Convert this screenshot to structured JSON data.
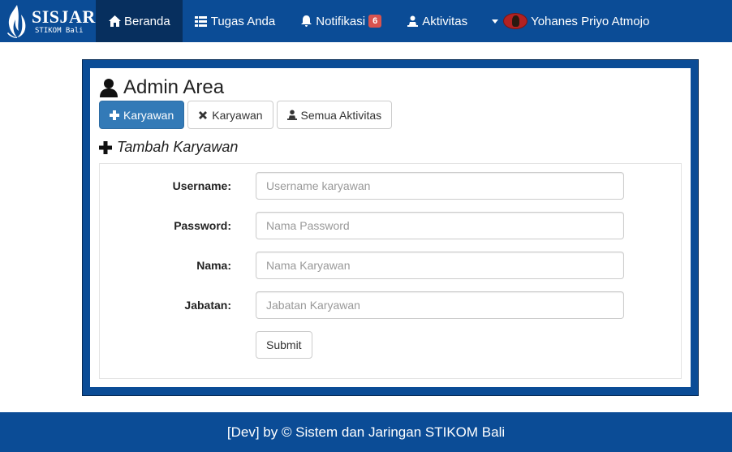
{
  "brand": {
    "title": "SISJAR",
    "subtitle": "STIKOM Bali"
  },
  "nav": {
    "items": [
      {
        "label": "Beranda",
        "icon": "home-icon"
      },
      {
        "label": "Tugas Anda",
        "icon": "list-icon"
      },
      {
        "label": "Notifikasi",
        "icon": "bell-icon",
        "badge": "6"
      },
      {
        "label": "Aktivitas",
        "icon": "user-icon"
      }
    ],
    "user": {
      "name": "Yohanes Priyo Atmojo"
    }
  },
  "page": {
    "title": "Admin Area",
    "buttons": {
      "add": "Karyawan",
      "remove": "Karyawan",
      "all": "Semua Aktivitas"
    },
    "section_title": "Tambah Karyawan"
  },
  "form": {
    "username": {
      "label": "Username:",
      "placeholder": "Username karyawan"
    },
    "password": {
      "label": "Password:",
      "placeholder": "Nama Password"
    },
    "nama": {
      "label": "Nama:",
      "placeholder": "Nama Karyawan"
    },
    "jabatan": {
      "label": "Jabatan:",
      "placeholder": "Jabatan Karyawan"
    },
    "submit": "Submit"
  },
  "footer": {
    "text": "[Dev] by © Sistem dan Jaringan STIKOM Bali"
  },
  "colors": {
    "navbar": "#0b4c96",
    "active_nav": "#072f5e",
    "primary": "#337ab7",
    "badge": "#d9534f"
  }
}
